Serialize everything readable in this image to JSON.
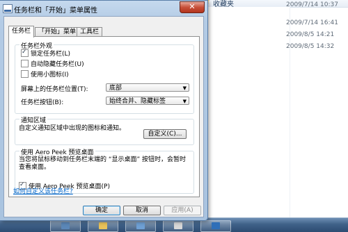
{
  "background": {
    "favorites_label": "收藏夹",
    "dates": [
      "2009/7/14 10:37",
      "2009/7/14 16:41",
      "2009/8/5 14:21",
      "2009/8/5 14:32"
    ]
  },
  "dialog": {
    "title": "任务栏和「开始」菜单属性",
    "close_label": "✕",
    "tabs": [
      "任务栏",
      "「开始」菜单",
      "工具栏"
    ],
    "appearance": {
      "title": "任务栏外观",
      "lock_taskbar": "锁定任务栏(L)",
      "lock_taskbar_checked": true,
      "auto_hide": "自动隐藏任务栏(U)",
      "auto_hide_checked": false,
      "small_icons": "使用小图标(I)",
      "small_icons_checked": false,
      "location_label": "屏幕上的任务栏位置(T):",
      "location_value": "底部",
      "buttons_label": "任务栏按钮(B):",
      "buttons_value": "始终合并、隐藏标签"
    },
    "notification": {
      "title": "通知区域",
      "description": "自定义通知区域中出现的图标和通知。",
      "customize_button": "自定义(C)..."
    },
    "aero_peek": {
      "title": "使用 Aero Peek 预览桌面",
      "description": "当您将鼠标移动到任务栏末端的 “显示桌面” 按钮时，会暂时查看桌面。",
      "checkbox_label": "使用 Aero Peek 预览桌面(P)",
      "checkbox_checked": true
    },
    "help_link": "如何自定义该任务栏?",
    "ok_button": "确定",
    "cancel_button": "取消",
    "apply_button": "应用(A)"
  }
}
